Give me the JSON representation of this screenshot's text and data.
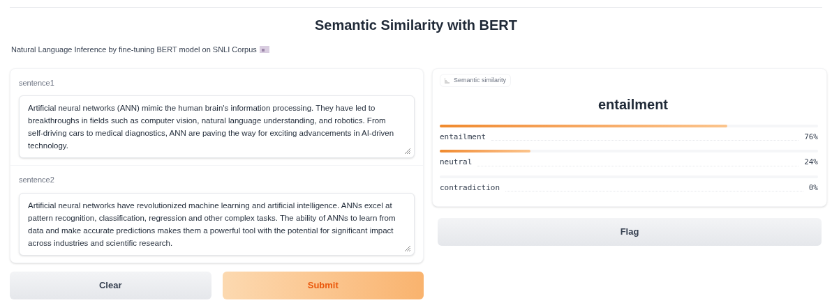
{
  "title": "Semantic Similarity with BERT",
  "description": "Natural Language Inference by fine-tuning BERT model on SNLI Corpus",
  "inputs": [
    {
      "label": "sentence1",
      "value": "Artificial neural networks (ANN) mimic the human brain's information processing. They have led to breakthroughs in fields such as computer vision, natural language understanding, and robotics. From self-driving cars to medical diagnostics, ANN are paving the way for exciting advancements in AI-driven technology."
    },
    {
      "label": "sentence2",
      "value": "Artificial neural networks have revolutionized machine learning and artificial intelligence. ANNs excel at pattern recognition, classification, regression and other complex tasks. The ability of ANNs to learn from data and make accurate predictions makes them a powerful tool with the potential for significant impact across industries and scientific research."
    }
  ],
  "buttons": [
    {
      "label": "Clear",
      "kind": "secondary"
    },
    {
      "label": "Submit",
      "kind": "primary"
    }
  ],
  "output": {
    "label": "Semantic similarity",
    "top_label": "entailment",
    "confidences": [
      {
        "label": "entailment",
        "level": 0.76,
        "reading": "76%"
      },
      {
        "label": "neutral",
        "level": 0.24,
        "reading": "24%"
      },
      {
        "label": "contradiction",
        "reading": "0%"
      }
    ]
  },
  "flag_button": "Flag"
}
